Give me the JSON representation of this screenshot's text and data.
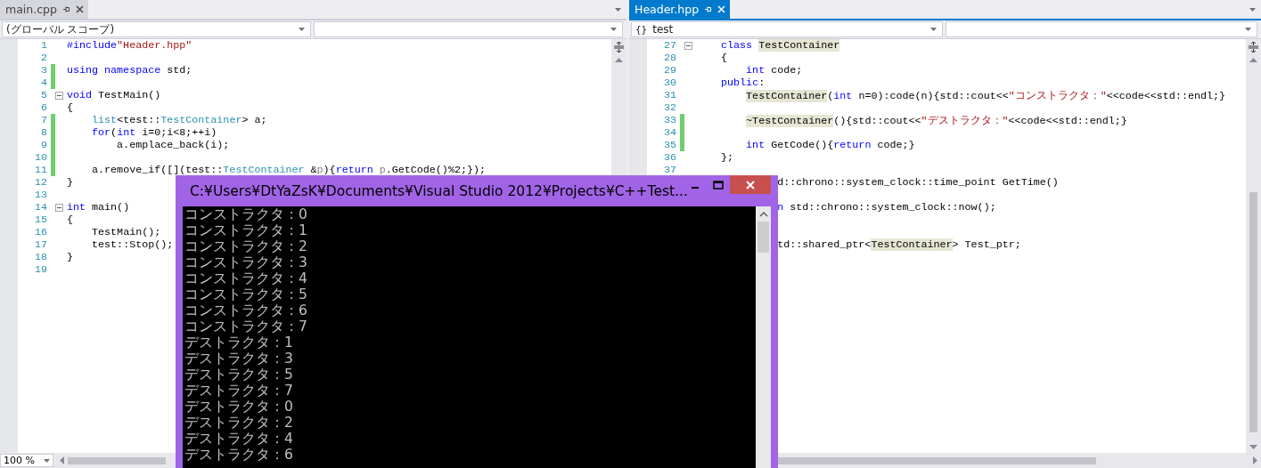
{
  "panes": [
    {
      "tab": {
        "label": "main.cpp",
        "selected": false
      },
      "scope": "(グローバル スコープ)",
      "zoom": "100 %",
      "lines": [
        {
          "number": "1",
          "changed": false,
          "fold": false,
          "segments": [
            {
              "text": "#include",
              "kind": "keyword"
            },
            {
              "text": "\"Header.hpp\"",
              "kind": "string"
            }
          ]
        },
        {
          "number": "2",
          "changed": false,
          "fold": false
        },
        {
          "number": "3",
          "changed": true,
          "fold": false,
          "segments": [
            {
              "text": "using namespace",
              "kind": "keyword"
            },
            {
              "text": " std;",
              "kind": "plain"
            }
          ]
        },
        {
          "number": "4",
          "changed": true,
          "fold": false
        },
        {
          "number": "5",
          "changed": false,
          "fold": true,
          "segments": [
            {
              "text": "void",
              "kind": "keyword"
            },
            {
              "text": " TestMain()",
              "kind": "plain"
            }
          ]
        },
        {
          "number": "6",
          "changed": false,
          "fold": false,
          "segments": [
            {
              "text": "{",
              "kind": "plain"
            }
          ]
        },
        {
          "number": "7",
          "changed": true,
          "fold": false,
          "segments": [
            {
              "text": "    list",
              "kind": "type"
            },
            {
              "text": "<test::",
              "kind": "plain"
            },
            {
              "text": "TestContainer",
              "kind": "type"
            },
            {
              "text": "> a;",
              "kind": "plain"
            }
          ]
        },
        {
          "number": "8",
          "changed": true,
          "fold": false,
          "segments": [
            {
              "text": "    for",
              "kind": "keyword"
            },
            {
              "text": "(",
              "kind": "plain"
            },
            {
              "text": "int",
              "kind": "keyword"
            },
            {
              "text": " i=0;i<8;++i)",
              "kind": "plain"
            }
          ]
        },
        {
          "number": "9",
          "changed": true,
          "fold": false,
          "segments": [
            {
              "text": "        a.emplace_back(i);",
              "kind": "plain"
            }
          ]
        },
        {
          "number": "10",
          "changed": true,
          "fold": false
        },
        {
          "number": "11",
          "changed": true,
          "fold": false,
          "segments": [
            {
              "text": "    a.remove_if([](test::",
              "kind": "plain"
            },
            {
              "text": "TestContainer",
              "kind": "type"
            },
            {
              "text": " &",
              "kind": "plain"
            },
            {
              "text": "p",
              "kind": "param"
            },
            {
              "text": "){",
              "kind": "plain"
            },
            {
              "text": "return ",
              "kind": "keyword"
            },
            {
              "text": "p",
              "kind": "param"
            },
            {
              "text": ".GetCode()%2;});",
              "kind": "plain"
            }
          ]
        },
        {
          "number": "12",
          "changed": false,
          "fold": false,
          "segments": [
            {
              "text": "}",
              "kind": "plain"
            }
          ]
        },
        {
          "number": "13",
          "changed": false,
          "fold": false
        },
        {
          "number": "14",
          "changed": false,
          "fold": true,
          "segments": [
            {
              "text": "int",
              "kind": "keyword"
            },
            {
              "text": " main()",
              "kind": "plain"
            }
          ]
        },
        {
          "number": "15",
          "changed": false,
          "fold": false,
          "segments": [
            {
              "text": "{",
              "kind": "plain"
            }
          ]
        },
        {
          "number": "16",
          "changed": false,
          "fold": false,
          "segments": [
            {
              "text": "    TestMain();",
              "kind": "plain"
            }
          ]
        },
        {
          "number": "17",
          "changed": false,
          "fold": false,
          "segments": [
            {
              "text": "    test::Stop();",
              "kind": "plain"
            }
          ]
        },
        {
          "number": "18",
          "changed": false,
          "fold": false,
          "segments": [
            {
              "text": "}",
              "kind": "plain"
            }
          ]
        },
        {
          "number": "19",
          "changed": false,
          "fold": false
        }
      ]
    },
    {
      "tab": {
        "label": "Header.hpp",
        "selected": true
      },
      "scope_icon": "{}",
      "scope": "test",
      "lines": [
        {
          "number": "27",
          "changed": false,
          "fold": true,
          "segments": [
            {
              "text": "    class ",
              "kind": "keyword"
            },
            {
              "text": "TestContainer",
              "kind": "reference"
            }
          ]
        },
        {
          "number": "28",
          "changed": false,
          "fold": false,
          "segments": [
            {
              "text": "    {",
              "kind": "plain"
            }
          ]
        },
        {
          "number": "29",
          "changed": false,
          "fold": false,
          "segments": [
            {
              "text": "        int",
              "kind": "keyword"
            },
            {
              "text": " code;",
              "kind": "plain"
            }
          ]
        },
        {
          "number": "30",
          "changed": false,
          "fold": false,
          "segments": [
            {
              "text": "    public",
              "kind": "keyword"
            },
            {
              "text": ":",
              "kind": "plain"
            }
          ]
        },
        {
          "number": "31",
          "changed": false,
          "fold": false,
          "segments": [
            {
              "text": "        TestContainer",
              "kind": "reference"
            },
            {
              "text": "(",
              "kind": "plain"
            },
            {
              "text": "int",
              "kind": "keyword"
            },
            {
              "text": " n=0):code(n){std::cout<<",
              "kind": "plain"
            },
            {
              "text": "\"コンストラクタ：\"",
              "kind": "string"
            },
            {
              "text": "<<code<<std::endl;}",
              "kind": "plain"
            }
          ]
        },
        {
          "number": "32",
          "changed": false,
          "fold": false
        },
        {
          "number": "33",
          "changed": true,
          "fold": false,
          "segments": [
            {
              "text": "        ~TestContainer",
              "kind": "reference"
            },
            {
              "text": "(){std::cout<<",
              "kind": "plain"
            },
            {
              "text": "\"デストラクタ：\"",
              "kind": "string"
            },
            {
              "text": "<<code<<std::endl;}",
              "kind": "plain"
            }
          ]
        },
        {
          "number": "34",
          "changed": true,
          "fold": false
        },
        {
          "number": "35",
          "changed": true,
          "fold": false,
          "segments": [
            {
              "text": "        int",
              "kind": "keyword"
            },
            {
              "text": " GetCode(){",
              "kind": "plain"
            },
            {
              "text": "return",
              "kind": "keyword"
            },
            {
              "text": " code;}",
              "kind": "plain"
            }
          ]
        },
        {
          "number": "36",
          "changed": false,
          "fold": false,
          "segments": [
            {
              "text": "    };",
              "kind": "plain"
            }
          ]
        },
        {
          "number": "37",
          "changed": false,
          "fold": false
        },
        {
          "kind": "clipped",
          "segments": [
            {
              "text": "d::chrono::system_clock::time_point GetTime()",
              "kind": "plain"
            }
          ]
        },
        {
          "kind": "clipped"
        },
        {
          "kind": "clipped",
          "segments": [
            {
              "text": "n",
              "kind": "keyword"
            },
            {
              "text": " std::chrono::system_clock::now();",
              "kind": "plain"
            }
          ]
        },
        {
          "kind": "clipped"
        },
        {
          "kind": "clipped"
        },
        {
          "kind": "clipped",
          "segments": [
            {
              "text": "td::shared_ptr<",
              "kind": "plain"
            },
            {
              "text": "TestContainer",
              "kind": "reference"
            },
            {
              "text": "> Test_ptr;",
              "kind": "plain"
            }
          ]
        }
      ]
    }
  ],
  "console": {
    "title": "C:¥Users¥DtYaZsK¥Documents¥Visual Studio 2012¥Projects¥C++Test...",
    "lines": [
      "コンストラクタ：0",
      "コンストラクタ：1",
      "コンストラクタ：2",
      "コンストラクタ：3",
      "コンストラクタ：4",
      "コンストラクタ：5",
      "コンストラクタ：6",
      "コンストラクタ：7",
      "デストラクタ：1",
      "デストラクタ：3",
      "デストラクタ：5",
      "デストラクタ：7",
      "デストラクタ：0",
      "デストラクタ：2",
      "デストラクタ：4",
      "デストラクタ：6"
    ]
  }
}
